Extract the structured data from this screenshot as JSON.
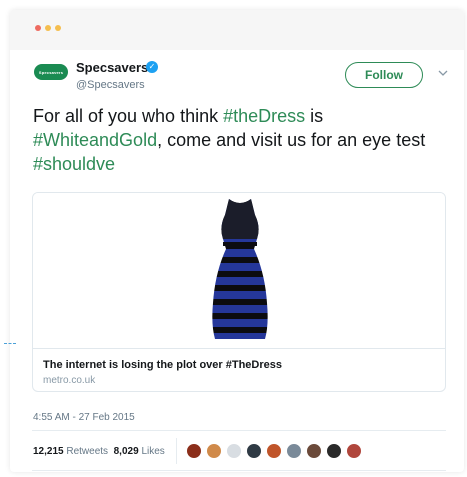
{
  "tweet": {
    "author": {
      "name": "Specsavers",
      "handle": "@Specsavers",
      "avatar_label": "Specsavers",
      "brand_color": "#1a8b52",
      "verified": true
    },
    "follow_label": "Follow",
    "text_parts": [
      {
        "text": "For all of you who think ",
        "hashtag": false
      },
      {
        "text": "#theDress",
        "hashtag": true
      },
      {
        "text": " is ",
        "hashtag": false
      },
      {
        "text": "#WhiteandGold",
        "hashtag": true
      },
      {
        "text": ", come and visit us for an eye test ",
        "hashtag": false
      },
      {
        "text": "#shouldve",
        "hashtag": true
      }
    ],
    "hashtag_color": "#2e8b57",
    "card": {
      "title": "The internet is losing the plot over #TheDress",
      "domain": "metro.co.uk",
      "image": "blue-and-black-dress"
    },
    "timestamp": "4:55 AM - 27 Feb 2015",
    "retweets_count": "12,215",
    "retweets_label": "Retweets",
    "likes_count": "8,029",
    "likes_label": "Likes",
    "liker_avatar_colors": [
      "#8b2e1a",
      "#d08a4a",
      "#d8dde2",
      "#2f3a44",
      "#c0552a",
      "#7a8a99",
      "#6b4a3a",
      "#2a2a2a",
      "#b0463c"
    ]
  }
}
